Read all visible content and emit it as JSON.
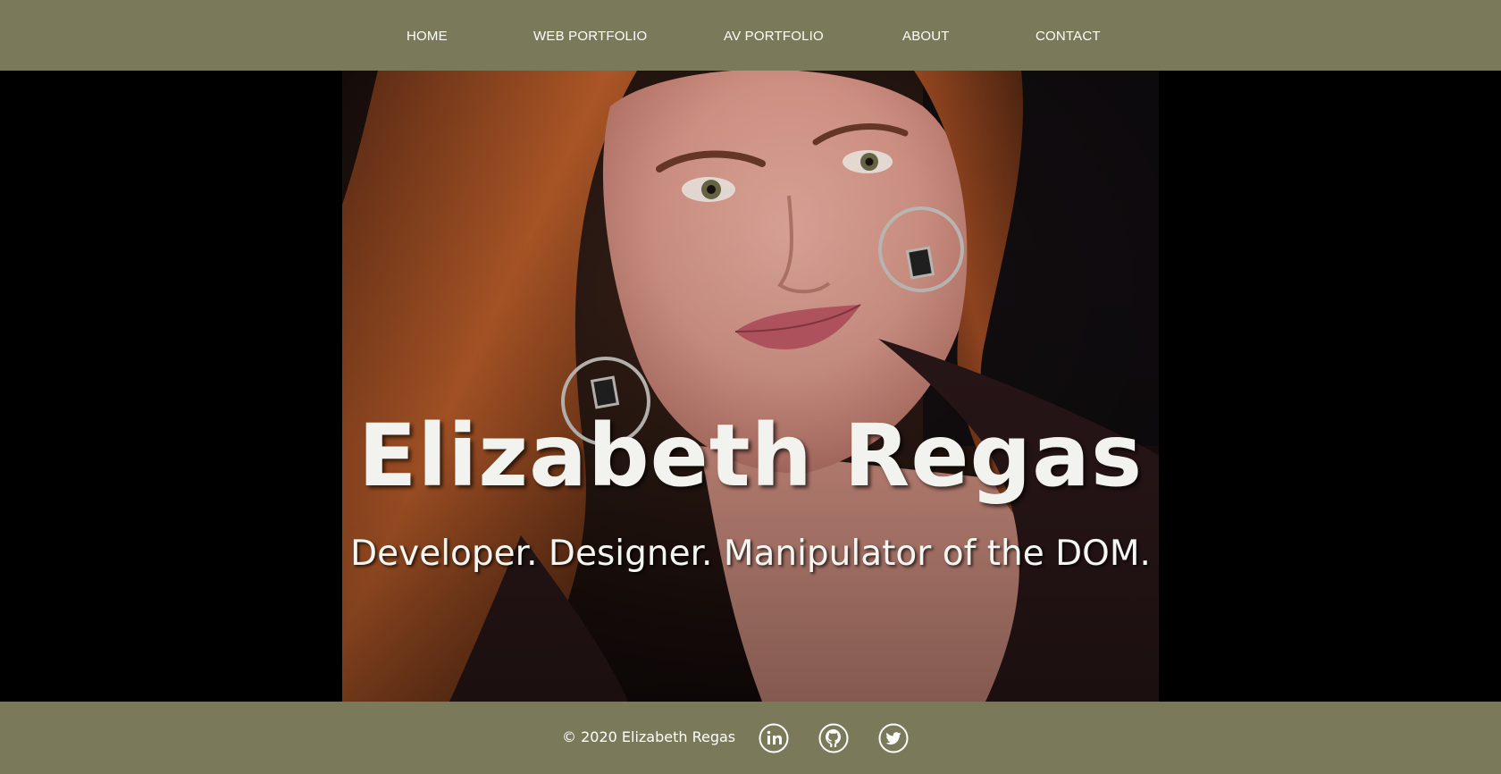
{
  "nav": {
    "items": [
      {
        "label": "HOME"
      },
      {
        "label": "WEB PORTFOLIO"
      },
      {
        "label": "AV PORTFOLIO"
      },
      {
        "label": "ABOUT"
      },
      {
        "label": "CONTACT"
      }
    ]
  },
  "hero": {
    "name": "Elizabeth Regas",
    "tagline": "Developer. Designer. Manipulator of the DOM."
  },
  "footer": {
    "copyright": "© 2020 Elizabeth Regas",
    "social": [
      {
        "icon": "linkedin-icon"
      },
      {
        "icon": "github-icon"
      },
      {
        "icon": "twitter-icon"
      }
    ]
  },
  "colors": {
    "bar_background": "#7a7a5a",
    "page_background": "#000000",
    "text": "#ffffff"
  }
}
